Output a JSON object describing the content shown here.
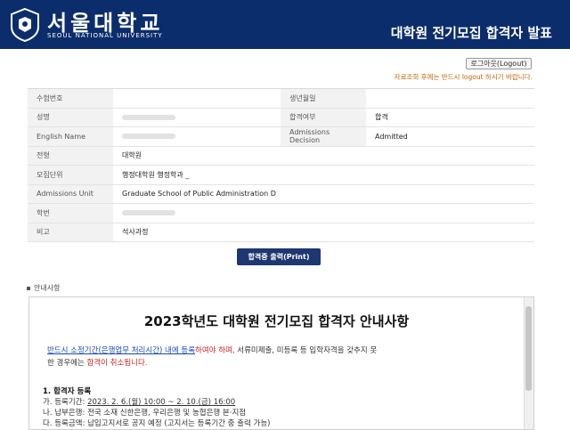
{
  "header": {
    "logo_ko": "서울대학교",
    "logo_en": "SEOUL NATIONAL UNIVERSITY",
    "title": "대학원 전기모집 합격자 발표"
  },
  "logout": {
    "button": "로그아웃(Logout)",
    "note": "자료조회 후에는 반드시 logout 하시기 바랍니다."
  },
  "info": {
    "exam_no_label": "수험번호",
    "birth_label": "생년월일",
    "name_label": "성명",
    "result_label": "합격여부",
    "result_value": "합격",
    "english_name_label": "English Name",
    "admission_decision_label": "Admissions Decision",
    "admission_decision_value": "Admitted",
    "program_label": "전형",
    "program_value": "대학원",
    "unit_label": "모집단위",
    "unit_value": "행정대학원 행정학과 _",
    "unit_en_label": "Admissions Unit",
    "unit_en_value": "Graduate School of Public Administration D",
    "student_no_label": "학번",
    "note_label": "비고",
    "note_value": "석사과정"
  },
  "print_button": "합격증 출력(Print)",
  "notice": {
    "label": "안내사항",
    "title": "2023학년도 대학원 전기모집 합격자 안내사항",
    "p_blue": "반드시 소정기간(은행업무 처리시간) 내에 등록",
    "p_red1": "하여야 하며,",
    "p_rest1": " 서류미제출, 미등록 등 입학자격을 갖추지 못",
    "p_rest2": "한 경우에는 ",
    "p_red2": "합격이 취소됩니다.",
    "section1": "1. 합격자 등록",
    "line1_label": "가. 등록기간:",
    "line1_value": "2023. 2. 6.(월) 10:00 ~ 2. 10.(금) 16:00",
    "line2": "나. 납부은행: 전국 소재 신한은행, 우리은행 및 농협은행 본·지점",
    "line3": "다. 등록금액: 납입고지서로 공지 예정 (고지서는 등록기간 중 출력 가능)"
  }
}
